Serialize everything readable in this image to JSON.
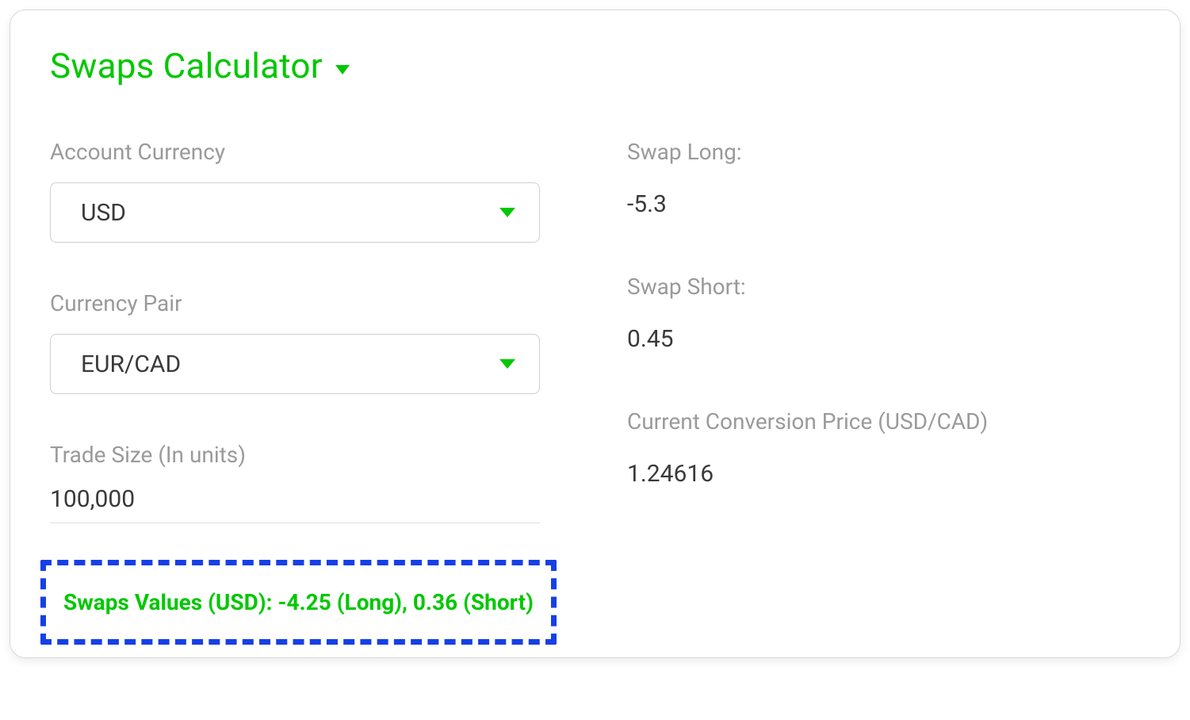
{
  "title": "Swaps Calculator",
  "fields": {
    "accountCurrency": {
      "label": "Account Currency",
      "value": "USD"
    },
    "currencyPair": {
      "label": "Currency Pair",
      "value": "EUR/CAD"
    },
    "tradeSize": {
      "label": "Trade Size (In units)",
      "value": "100,000"
    }
  },
  "results": {
    "swapLong": {
      "label": "Swap Long:",
      "value": "-5.3"
    },
    "swapShort": {
      "label": "Swap Short:",
      "value": "0.45"
    },
    "conversionPrice": {
      "label": "Current Conversion Price (USD/CAD)",
      "value": "1.24616"
    }
  },
  "highlight": "Swaps Values (USD): -4.25 (Long), 0.36 (Short)"
}
